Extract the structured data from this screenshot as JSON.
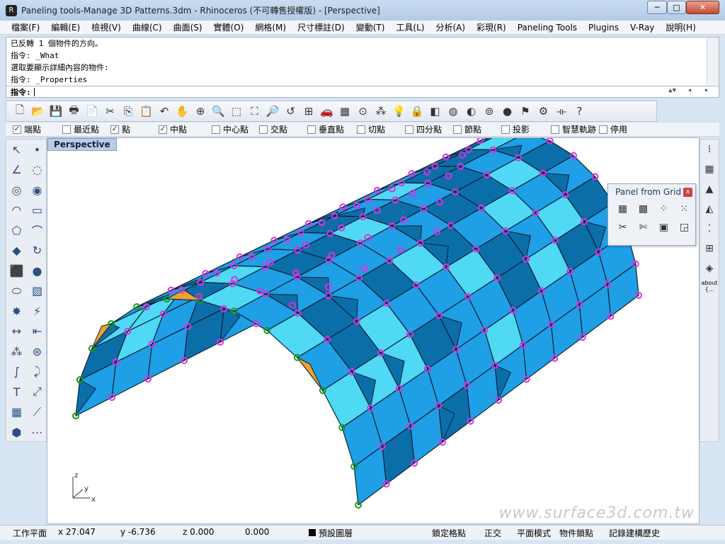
{
  "window": {
    "title": "Paneling tools-Manage 3D Patterns.3dm - Rhinoceros (不可轉售授權版) - [Perspective]",
    "min_label": "─",
    "max_label": "□",
    "close_label": "✕"
  },
  "menu": [
    "檔案(F)",
    "編輯(E)",
    "檢視(V)",
    "曲線(C)",
    "曲面(S)",
    "實體(O)",
    "網格(M)",
    "尺寸標註(D)",
    "變動(T)",
    "工具(L)",
    "分析(A)",
    "彩現(R)",
    "Paneling Tools",
    "Plugins",
    "V-Ray",
    "說明(H)"
  ],
  "command": {
    "history": [
      "已反轉 1 個物件的方向。",
      "指令: _What",
      "選取要顯示詳細內容的物件:",
      "指令: _Properties"
    ],
    "prompt_label": "指令:",
    "input_value": "",
    "arrows": "◂ ▸"
  },
  "toolbar_icons": [
    "new-icon",
    "open-icon",
    "save-icon",
    "print-icon",
    "import-icon",
    "cut-icon",
    "copy-icon",
    "paste-icon",
    "undo-icon",
    "pan-icon",
    "rotate-view-icon",
    "zoom-icon",
    "zoom-window-icon",
    "zoom-extents-icon",
    "zoom-selected-icon",
    "undo-view-icon",
    "four-views-icon",
    "car-icon",
    "grid-icon",
    "snap-icon",
    "lights-icon",
    "bulb-icon",
    "lock-icon",
    "layer-icon",
    "color-wheel-icon",
    "sphere-icon",
    "wire-sphere-icon",
    "shaded-sphere-icon",
    "flag-icon",
    "gear-icon",
    "dimension-icon",
    "help-icon"
  ],
  "toolbar_glyphs": [
    "🗋",
    "📂",
    "💾",
    "🖶",
    "📄",
    "✂",
    "⎘",
    "📋",
    "↶",
    "✋",
    "⊕",
    "🔍",
    "⬚",
    "⛶",
    "🔎",
    "↺",
    "⊞",
    "🚗",
    "▦",
    "⊙",
    "⁂",
    "💡",
    "🔒",
    "◧",
    "◍",
    "◐",
    "⊚",
    "●",
    "⚑",
    "⚙",
    "⟛",
    "?"
  ],
  "osnaps": [
    {
      "label": "端點",
      "checked": true
    },
    {
      "label": "最近點",
      "checked": false
    },
    {
      "label": "點",
      "checked": true
    },
    {
      "label": "中點",
      "checked": true
    },
    {
      "label": "中心點",
      "checked": false
    },
    {
      "label": "交點",
      "checked": false
    },
    {
      "label": "垂直點",
      "checked": false
    },
    {
      "label": "切點",
      "checked": false
    },
    {
      "label": "四分點",
      "checked": false
    },
    {
      "label": "節點",
      "checked": false
    },
    {
      "label": "投影",
      "checked": false
    },
    {
      "label": "智慧軌跡",
      "checked": false
    },
    {
      "label": "停用",
      "checked": false
    }
  ],
  "left_tools": [
    "select-icon",
    "point-icon",
    "polyline-icon",
    "curve-icon",
    "circle-icon",
    "ellipse-icon",
    "arc-icon",
    "rectangle-icon",
    "polygon-icon",
    "fillet-icon",
    "surface-icon",
    "revolve-icon",
    "box-icon",
    "sphere-tool-icon",
    "cylinder-icon",
    "mesh-icon",
    "explode-icon",
    "boolean-icon",
    "move-icon",
    "align-icon",
    "blob-icon",
    "group-icon",
    "bend-icon",
    "curve-offset-icon",
    "text-icon",
    "transform-icon",
    "array-icon",
    "measure-icon",
    "block-icon",
    "dim-icon"
  ],
  "left_glyphs": [
    "↖",
    "•",
    "∠",
    "◌",
    "◎",
    "◉",
    "◠",
    "▭",
    "⬠",
    "⌒",
    "◆",
    "↻",
    "⬛",
    "●",
    "⬭",
    "▧",
    "✸",
    "⚡",
    "↔",
    "⇤",
    "⁂",
    "⊛",
    "∫",
    "⤸",
    "T",
    "⤢",
    "▦",
    "⟋",
    "⬢",
    "⋯"
  ],
  "viewport": {
    "tab_label": "Perspective",
    "axis_z": "z",
    "axis_y": "y",
    "axis_x": "x",
    "watermark": "www.surface3d.com.tw"
  },
  "panel": {
    "title": "Panel from Grid",
    "close": "x",
    "buttons": [
      "panel-grid-icon",
      "panel-grid-bounded-icon",
      "panel-dots-icon",
      "panel-dots-red-icon",
      "panel-cut-icon",
      "panel-cut-red-icon",
      "panel-blue-grid-icon",
      "panel-frame-icon"
    ],
    "glyphs": [
      "▦",
      "▩",
      "⁘",
      "⁙",
      "✂",
      "✄",
      "▣",
      "◲"
    ]
  },
  "right_tools": [
    "dots-icon",
    "grid-points-icon",
    "triangle-icon",
    "wire-icon",
    "points-array-icon",
    "red-grid-icon",
    "diamond-icon"
  ],
  "right_glyphs": [
    "⁞",
    "▦",
    "▲",
    "◭",
    "⁚",
    "⊞",
    "◈"
  ],
  "right_about": "about\n{...",
  "status": {
    "cplane": "工作平面",
    "x": "x 27.047",
    "y": "y -6.736",
    "z": "z 0.000",
    "extra": "0.000",
    "layer": "預設圖層",
    "grid_snap": "鎖定格點",
    "ortho": "正交",
    "planar": "平面模式",
    "osnap": "物件鎖點",
    "history": "記錄建構歷史"
  },
  "colors": {
    "panel_blue": "#1e9fe6",
    "panel_light": "#4fd9f5",
    "panel_dark": "#0b6ea8",
    "vertex_magenta": "#e22ee2",
    "vertex_green": "#1a9a1a",
    "accent_orange": "#f0a030"
  }
}
